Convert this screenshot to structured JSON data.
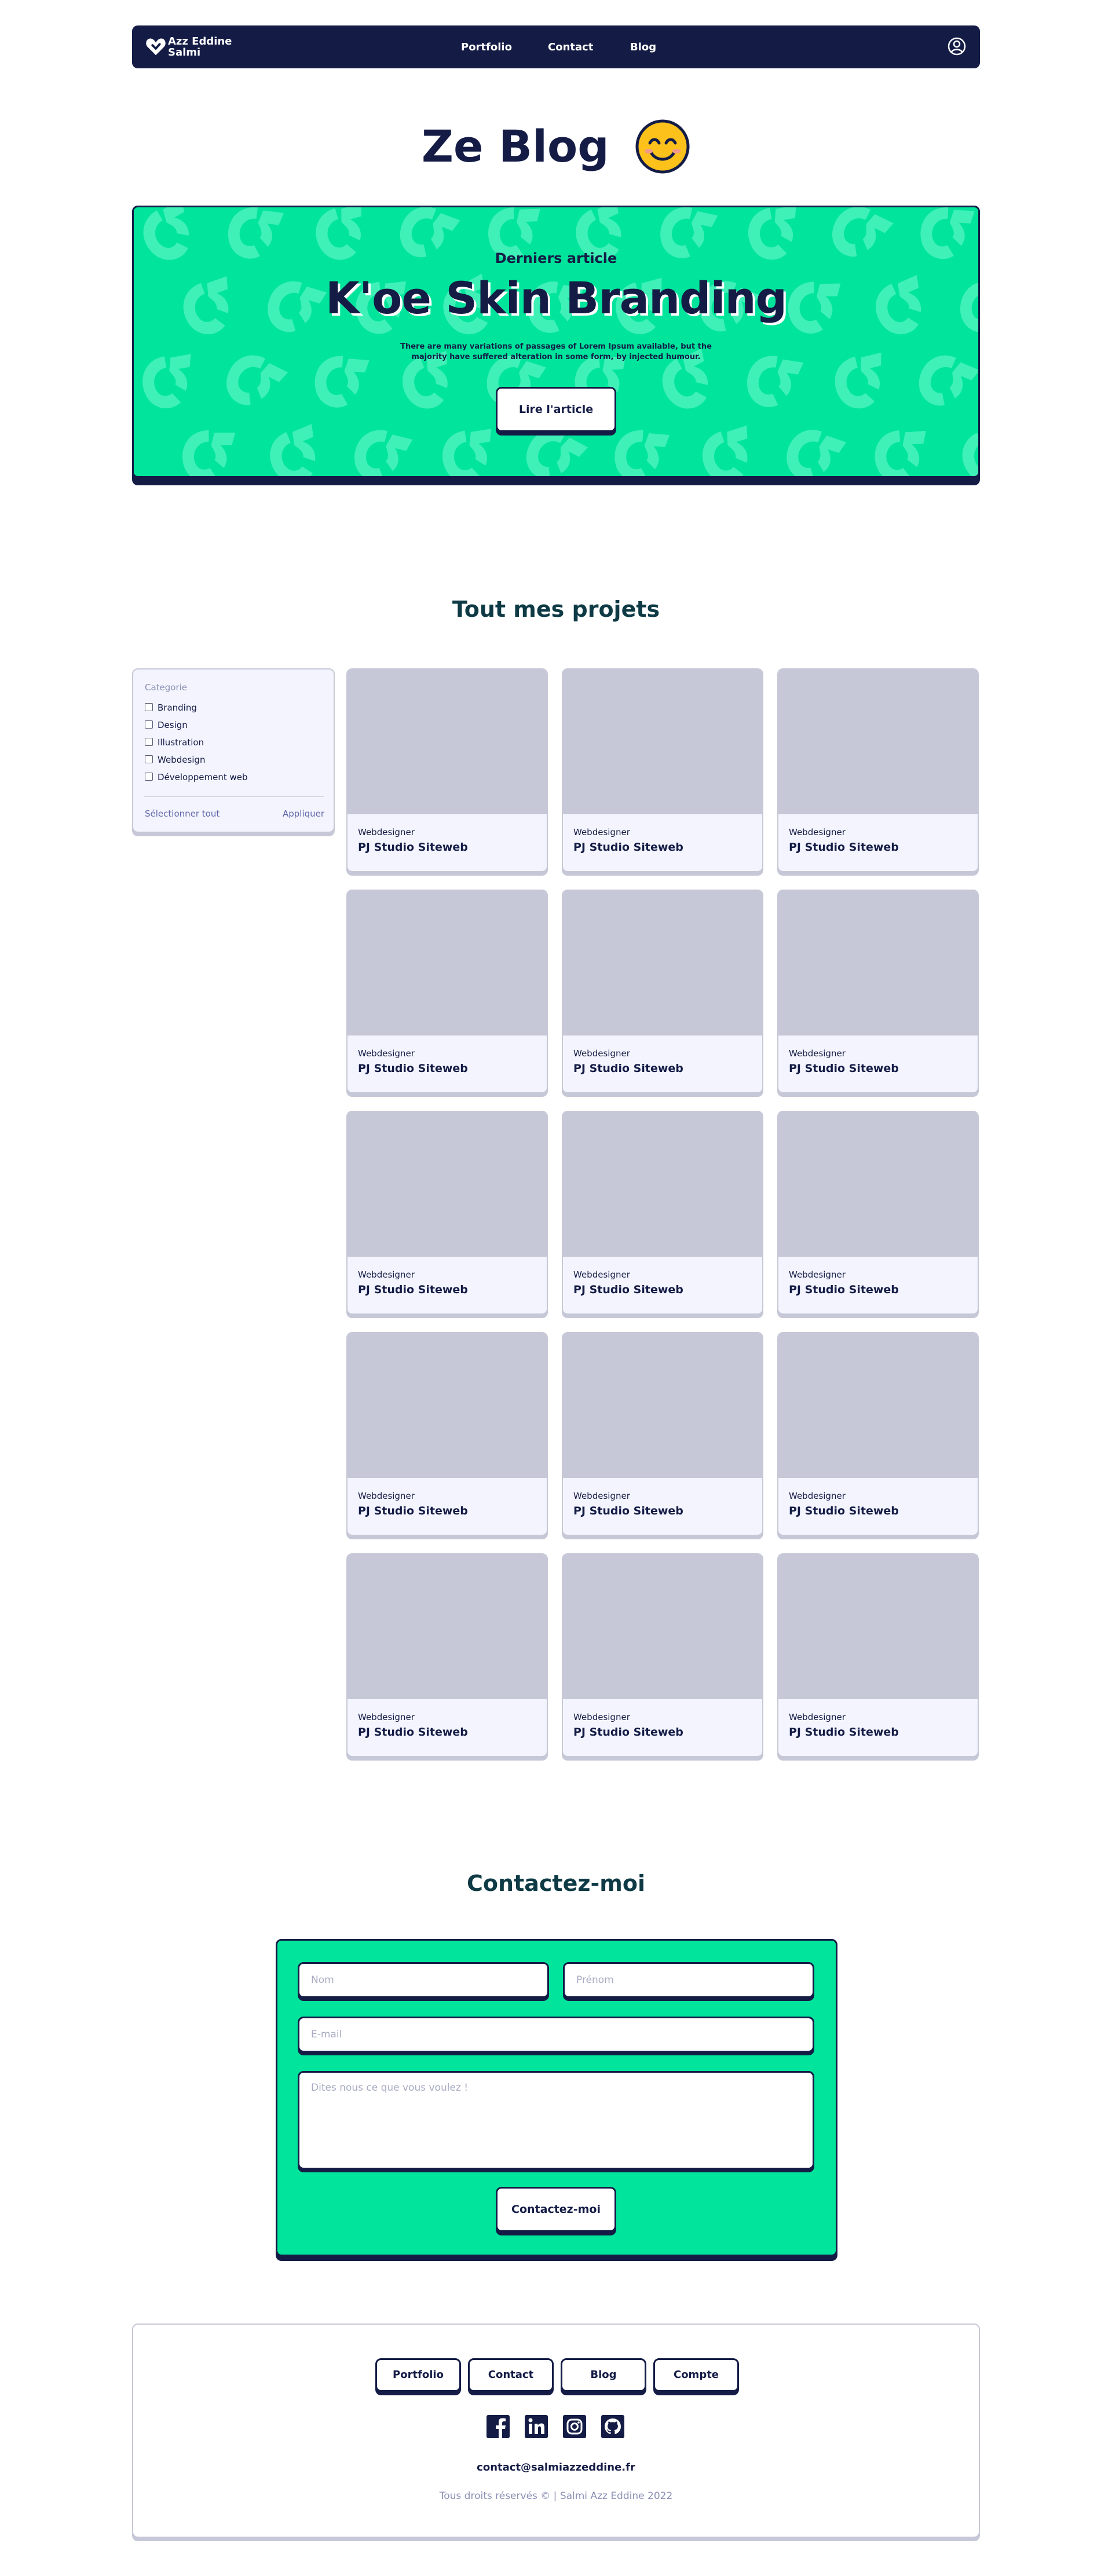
{
  "colors": {
    "navy": "#141c46",
    "accent_green": "#00e59b",
    "card_bg": "#f3f4fd",
    "placeholder_gray": "#c6c8d7",
    "muted_text": "#8a8fb4",
    "section_title": "#0e3a45"
  },
  "nav": {
    "logo_icon": "heart-logo-icon",
    "logo_line1": "Azz Eddine",
    "logo_line2": "Salmi",
    "links": [
      "Portfolio",
      "Contact",
      "Blog"
    ],
    "account_icon": "user-circle-icon"
  },
  "page": {
    "title": "Ze Blog",
    "title_emoji": "smiling-face-icon"
  },
  "hero": {
    "eyebrow": "Derniers article",
    "title": "K'oe Skin Branding",
    "description": "There are many variations of passages of Lorem Ipsum available, but the majority have suffered alteration in some form, by injected humour.",
    "button": "Lire l'article"
  },
  "projects": {
    "title": "Tout mes projets",
    "filter": {
      "label": "Categorie",
      "options": [
        "Branding",
        "Design",
        "Illustration",
        "Webdesign",
        "Développement web"
      ],
      "select_all": "Sélectionner tout",
      "apply": "Appliquer"
    },
    "cards": [
      {
        "category": "Webdesigner",
        "title": "PJ Studio Siteweb"
      },
      {
        "category": "Webdesigner",
        "title": "PJ Studio Siteweb"
      },
      {
        "category": "Webdesigner",
        "title": "PJ Studio Siteweb"
      },
      {
        "category": "Webdesigner",
        "title": "PJ Studio Siteweb"
      },
      {
        "category": "Webdesigner",
        "title": "PJ Studio Siteweb"
      },
      {
        "category": "Webdesigner",
        "title": "PJ Studio Siteweb"
      },
      {
        "category": "Webdesigner",
        "title": "PJ Studio Siteweb"
      },
      {
        "category": "Webdesigner",
        "title": "PJ Studio Siteweb"
      },
      {
        "category": "Webdesigner",
        "title": "PJ Studio Siteweb"
      },
      {
        "category": "Webdesigner",
        "title": "PJ Studio Siteweb"
      },
      {
        "category": "Webdesigner",
        "title": "PJ Studio Siteweb"
      },
      {
        "category": "Webdesigner",
        "title": "PJ Studio Siteweb"
      },
      {
        "category": "Webdesigner",
        "title": "PJ Studio Siteweb"
      },
      {
        "category": "Webdesigner",
        "title": "PJ Studio Siteweb"
      },
      {
        "category": "Webdesigner",
        "title": "PJ Studio Siteweb"
      }
    ]
  },
  "contact": {
    "title": "Contactez-moi",
    "last_name_placeholder": "Nom",
    "first_name_placeholder": "Prénom",
    "email_placeholder": "E-mail",
    "message_placeholder": "Dites nous ce que vous voulez !",
    "submit": "Contactez-moi"
  },
  "footer": {
    "links": [
      "Portfolio",
      "Contact",
      "Blog",
      "Compte"
    ],
    "socials": [
      "facebook-icon",
      "linkedin-icon",
      "instagram-icon",
      "github-icon"
    ],
    "email": "contact@salmiazzeddine.fr",
    "copyright": "Tous droits réservés © | Salmi Azz Eddine 2022"
  }
}
